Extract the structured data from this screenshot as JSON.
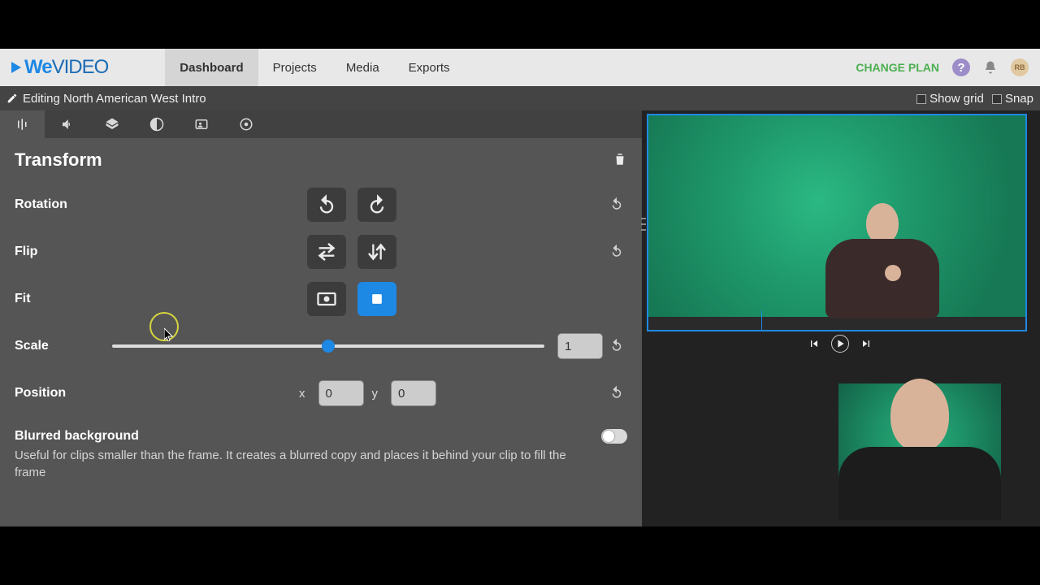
{
  "header": {
    "logo": "WeVIDEO",
    "nav": [
      "Dashboard",
      "Projects",
      "Media",
      "Exports"
    ],
    "active_nav_index": 0,
    "change_plan": "CHANGE PLAN",
    "avatar_initials": "RB"
  },
  "subheader": {
    "title": "Editing North American West Intro",
    "show_grid_label": "Show grid",
    "snap_label": "Snap"
  },
  "panel": {
    "title": "Transform",
    "rows": {
      "rotation": {
        "label": "Rotation"
      },
      "flip": {
        "label": "Flip"
      },
      "fit": {
        "label": "Fit"
      },
      "scale": {
        "label": "Scale",
        "value": "1",
        "slider_pos_percent": 50
      },
      "position": {
        "label": "Position",
        "x_label": "x",
        "y_label": "y",
        "x": "0",
        "y": "0"
      },
      "blur": {
        "label": "Blurred background",
        "desc": "Useful for clips smaller than the frame. It creates a blurred copy and places it behind your clip to fill the frame",
        "on": false
      }
    }
  },
  "icons": {
    "edit_tabs": [
      "sliders-icon",
      "volume-icon",
      "layers-icon",
      "contrast-icon",
      "user-card-icon",
      "subtitle-icon"
    ],
    "reset": "undo-icon"
  }
}
